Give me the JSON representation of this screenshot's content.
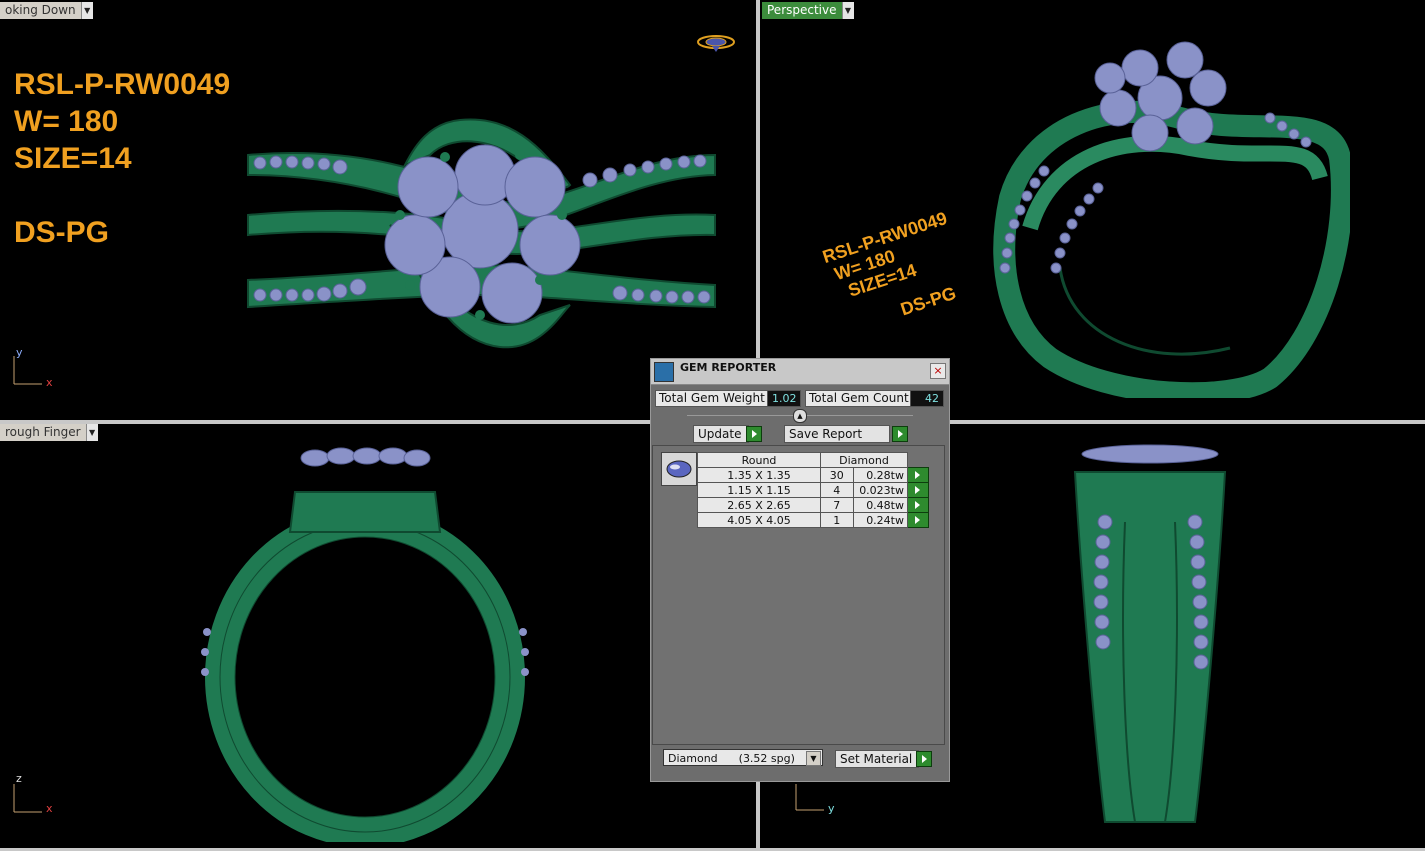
{
  "viewports": {
    "top_left": {
      "label": "oking Down"
    },
    "top_right": {
      "label": "Perspective"
    },
    "bottom_left": {
      "label": "rough Finger"
    }
  },
  "annotation_large": [
    "RSL-P-RW0049",
    "W= 180",
    "SIZE=14",
    "",
    "DS-PG"
  ],
  "annotation_perspective": [
    "RSL-P-RW0049",
    "W= 180",
    "SIZE=14",
    "DS-PG"
  ],
  "axes": {
    "y": "y",
    "x": "x",
    "z": "z"
  },
  "colors": {
    "metal": "#1f7a52",
    "gem": "#8a92c8",
    "annotation": "#f0a020",
    "active_tab": "#3c8c3c"
  },
  "dialog": {
    "title": "GEM REPORTER",
    "close_label": "×",
    "total_weight_label": "Total Gem Weight",
    "total_weight_value": "1.02",
    "total_count_label": "Total Gem Count",
    "total_count_value": "42",
    "update_label": "Update",
    "save_report_label": "Save Report",
    "table": {
      "header_shape": "Round",
      "header_material": "Diamond",
      "rows": [
        {
          "size": "1.35 X 1.35",
          "count": "30",
          "weight": "0.28tw"
        },
        {
          "size": "1.15 X 1.15",
          "count": "4",
          "weight": "0.023tw"
        },
        {
          "size": "2.65 X 2.65",
          "count": "7",
          "weight": "0.48tw"
        },
        {
          "size": "4.05 X 4.05",
          "count": "1",
          "weight": "0.24tw"
        }
      ]
    },
    "material_select": "Diamond      (3.52 spg)",
    "set_material_label": "Set Material"
  }
}
